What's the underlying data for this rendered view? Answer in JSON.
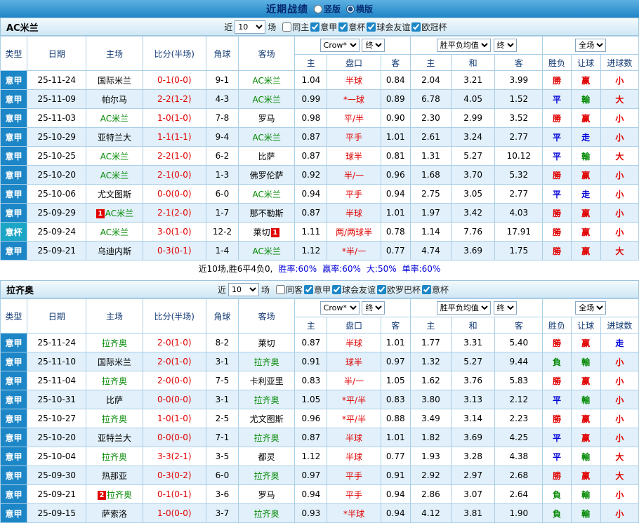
{
  "topbar": {
    "title": "近期战绩",
    "vertical_label": "竖版",
    "horizontal_label": "横版",
    "selected": "横版"
  },
  "table_header": {
    "type": "类型",
    "date": "日期",
    "home": "主场",
    "score": "比分(半场)",
    "corner": "角球",
    "away": "客场",
    "odds_select": "Crow*",
    "final_select": "终",
    "avg_select": "胜平负均值",
    "scope_select": "全场",
    "sub_cols": [
      "主",
      "盘口",
      "客",
      "主",
      "和",
      "客",
      "胜负",
      "让球",
      "进球数"
    ]
  },
  "colors": {
    "league_bg": "#1c86c7",
    "cup_bg": "#1ba6c6",
    "win_red": "#e10000",
    "draw_blue": "#0000d9",
    "lose_green": "#008800"
  },
  "sections": [
    {
      "team": "AC米兰",
      "filter": {
        "near": "近",
        "count": "10",
        "games": "场",
        "checkboxes": [
          {
            "label": "同主",
            "checked": false
          },
          {
            "label": "意甲",
            "checked": true
          },
          {
            "label": "意杯",
            "checked": true
          },
          {
            "label": "球会友谊",
            "checked": true
          },
          {
            "label": "欧冠杯",
            "checked": true
          }
        ]
      },
      "rows": [
        {
          "type": "意甲",
          "type_c": "league",
          "date": "25-11-24",
          "home": "国际米兰",
          "home_green": false,
          "home_badge": "",
          "score": "0-1(0-0)",
          "corner": "9-1",
          "away": "AC米兰",
          "away_green": true,
          "away_badge": "",
          "o1": "1.04",
          "hcap": "半球",
          "o2": "0.84",
          "a1": "2.04",
          "a2": "3.21",
          "a3": "3.99",
          "res": "勝",
          "res_c": "r",
          "let": "赢",
          "let_c": "r",
          "goal": "小",
          "goal_c": "r"
        },
        {
          "type": "意甲",
          "type_c": "league",
          "date": "25-11-09",
          "home": "帕尔马",
          "home_green": false,
          "home_badge": "",
          "score": "2-2(1-2)",
          "corner": "4-3",
          "away": "AC米兰",
          "away_green": true,
          "away_badge": "",
          "o1": "0.99",
          "hcap": "*一球",
          "o2": "0.89",
          "a1": "6.78",
          "a2": "4.05",
          "a3": "1.52",
          "res": "平",
          "res_c": "b",
          "let": "輸",
          "let_c": "g",
          "goal": "大",
          "goal_c": "r"
        },
        {
          "type": "意甲",
          "type_c": "league",
          "date": "25-11-03",
          "home": "AC米兰",
          "home_green": true,
          "home_badge": "",
          "score": "1-0(1-0)",
          "corner": "7-8",
          "away": "罗马",
          "away_green": false,
          "away_badge": "",
          "o1": "0.98",
          "hcap": "平/半",
          "o2": "0.90",
          "a1": "2.30",
          "a2": "2.99",
          "a3": "3.52",
          "res": "勝",
          "res_c": "r",
          "let": "赢",
          "let_c": "r",
          "goal": "小",
          "goal_c": "r"
        },
        {
          "type": "意甲",
          "type_c": "league",
          "date": "25-10-29",
          "home": "亚特兰大",
          "home_green": false,
          "home_badge": "",
          "score": "1-1(1-1)",
          "corner": "9-4",
          "away": "AC米兰",
          "away_green": true,
          "away_badge": "",
          "o1": "0.87",
          "hcap": "平手",
          "o2": "1.01",
          "a1": "2.61",
          "a2": "3.24",
          "a3": "2.77",
          "res": "平",
          "res_c": "b",
          "let": "走",
          "let_c": "b",
          "goal": "小",
          "goal_c": "r"
        },
        {
          "type": "意甲",
          "type_c": "league",
          "date": "25-10-25",
          "home": "AC米兰",
          "home_green": true,
          "home_badge": "",
          "score": "2-2(1-0)",
          "corner": "6-2",
          "away": "比萨",
          "away_green": false,
          "away_badge": "",
          "o1": "0.87",
          "hcap": "球半",
          "o2": "0.81",
          "a1": "1.31",
          "a2": "5.27",
          "a3": "10.12",
          "res": "平",
          "res_c": "b",
          "let": "輸",
          "let_c": "g",
          "goal": "大",
          "goal_c": "r"
        },
        {
          "type": "意甲",
          "type_c": "league",
          "date": "25-10-20",
          "home": "AC米兰",
          "home_green": true,
          "home_badge": "",
          "score": "2-1(0-0)",
          "corner": "1-3",
          "away": "佛罗伦萨",
          "away_green": false,
          "away_badge": "",
          "o1": "0.92",
          "hcap": "半/一",
          "o2": "0.96",
          "a1": "1.68",
          "a2": "3.70",
          "a3": "5.32",
          "res": "勝",
          "res_c": "r",
          "let": "赢",
          "let_c": "r",
          "goal": "小",
          "goal_c": "r"
        },
        {
          "type": "意甲",
          "type_c": "league",
          "date": "25-10-06",
          "home": "尤文图斯",
          "home_green": false,
          "home_badge": "",
          "score": "0-0(0-0)",
          "corner": "6-0",
          "away": "AC米兰",
          "away_green": true,
          "away_badge": "",
          "o1": "0.94",
          "hcap": "平手",
          "o2": "0.94",
          "a1": "2.75",
          "a2": "3.05",
          "a3": "2.77",
          "res": "平",
          "res_c": "b",
          "let": "走",
          "let_c": "b",
          "goal": "小",
          "goal_c": "r"
        },
        {
          "type": "意甲",
          "type_c": "league",
          "date": "25-09-29",
          "home": "AC米兰",
          "home_green": true,
          "home_badge": "1",
          "score": "2-1(2-0)",
          "corner": "1-7",
          "away": "那不勒斯",
          "away_green": false,
          "away_badge": "",
          "o1": "0.87",
          "hcap": "半球",
          "o2": "1.01",
          "a1": "1.97",
          "a2": "3.42",
          "a3": "4.03",
          "res": "勝",
          "res_c": "r",
          "let": "赢",
          "let_c": "r",
          "goal": "小",
          "goal_c": "r"
        },
        {
          "type": "意杯",
          "type_c": "cup",
          "date": "25-09-24",
          "home": "AC米兰",
          "home_green": true,
          "home_badge": "",
          "score": "3-0(1-0)",
          "corner": "12-2",
          "away": "莱切",
          "away_green": false,
          "away_badge": "1",
          "o1": "1.11",
          "hcap": "两/两球半",
          "o2": "0.78",
          "a1": "1.14",
          "a2": "7.76",
          "a3": "17.91",
          "res": "勝",
          "res_c": "r",
          "let": "赢",
          "let_c": "r",
          "goal": "小",
          "goal_c": "r"
        },
        {
          "type": "意甲",
          "type_c": "league",
          "date": "25-09-21",
          "home": "乌迪内斯",
          "home_green": false,
          "home_badge": "",
          "score": "0-3(0-1)",
          "corner": "1-4",
          "away": "AC米兰",
          "away_green": true,
          "away_badge": "",
          "o1": "1.12",
          "hcap": "*半/一",
          "o2": "0.77",
          "a1": "4.74",
          "a2": "3.69",
          "a3": "1.75",
          "res": "勝",
          "res_c": "r",
          "let": "赢",
          "let_c": "r",
          "goal": "大",
          "goal_c": "r"
        }
      ],
      "footer": {
        "plain": "近10场,胜6平4负0,",
        "stats": [
          {
            "text": "胜率:60%",
            "c": "b"
          },
          {
            "text": "赢率:60%",
            "c": "b"
          },
          {
            "text": "大:50%",
            "c": "b"
          },
          {
            "text": "单率:60%",
            "c": "b"
          }
        ]
      }
    },
    {
      "team": "拉齐奥",
      "filter": {
        "near": "近",
        "count": "10",
        "games": "场",
        "checkboxes": [
          {
            "label": "同客",
            "checked": false
          },
          {
            "label": "意甲",
            "checked": true
          },
          {
            "label": "球会友谊",
            "checked": true
          },
          {
            "label": "欧罗巴杯",
            "checked": true
          },
          {
            "label": "意杯",
            "checked": true
          }
        ]
      },
      "rows": [
        {
          "type": "意甲",
          "type_c": "league",
          "date": "25-11-24",
          "home": "拉齐奥",
          "home_green": true,
          "home_badge": "",
          "score": "2-0(1-0)",
          "corner": "8-2",
          "away": "莱切",
          "away_green": false,
          "away_badge": "",
          "o1": "0.87",
          "hcap": "半球",
          "o2": "1.01",
          "a1": "1.77",
          "a2": "3.31",
          "a3": "5.40",
          "res": "勝",
          "res_c": "r",
          "let": "赢",
          "let_c": "r",
          "goal": "走",
          "goal_c": "b"
        },
        {
          "type": "意甲",
          "type_c": "league",
          "date": "25-11-10",
          "home": "国际米兰",
          "home_green": false,
          "home_badge": "",
          "score": "2-0(1-0)",
          "corner": "3-1",
          "away": "拉齐奥",
          "away_green": true,
          "away_badge": "",
          "o1": "0.91",
          "hcap": "球半",
          "o2": "0.97",
          "a1": "1.32",
          "a2": "5.27",
          "a3": "9.44",
          "res": "負",
          "res_c": "g",
          "let": "輸",
          "let_c": "g",
          "goal": "小",
          "goal_c": "r"
        },
        {
          "type": "意甲",
          "type_c": "league",
          "date": "25-11-04",
          "home": "拉齐奥",
          "home_green": true,
          "home_badge": "",
          "score": "2-0(0-0)",
          "corner": "7-5",
          "away": "卡利亚里",
          "away_green": false,
          "away_badge": "",
          "o1": "0.83",
          "hcap": "半/一",
          "o2": "1.05",
          "a1": "1.62",
          "a2": "3.76",
          "a3": "5.83",
          "res": "勝",
          "res_c": "r",
          "let": "赢",
          "let_c": "r",
          "goal": "小",
          "goal_c": "r"
        },
        {
          "type": "意甲",
          "type_c": "league",
          "date": "25-10-31",
          "home": "比萨",
          "home_green": false,
          "home_badge": "",
          "score": "0-0(0-0)",
          "corner": "3-1",
          "away": "拉齐奥",
          "away_green": true,
          "away_badge": "",
          "o1": "1.05",
          "hcap": "*平/半",
          "o2": "0.83",
          "a1": "3.80",
          "a2": "3.13",
          "a3": "2.12",
          "res": "平",
          "res_c": "b",
          "let": "輸",
          "let_c": "g",
          "goal": "小",
          "goal_c": "r"
        },
        {
          "type": "意甲",
          "type_c": "league",
          "date": "25-10-27",
          "home": "拉齐奥",
          "home_green": true,
          "home_badge": "",
          "score": "1-0(1-0)",
          "corner": "2-5",
          "away": "尤文图斯",
          "away_green": false,
          "away_badge": "",
          "o1": "0.96",
          "hcap": "*平/半",
          "o2": "0.88",
          "a1": "3.49",
          "a2": "3.14",
          "a3": "2.23",
          "res": "勝",
          "res_c": "r",
          "let": "赢",
          "let_c": "r",
          "goal": "小",
          "goal_c": "r"
        },
        {
          "type": "意甲",
          "type_c": "league",
          "date": "25-10-20",
          "home": "亚特兰大",
          "home_green": false,
          "home_badge": "",
          "score": "0-0(0-0)",
          "corner": "7-1",
          "away": "拉齐奥",
          "away_green": true,
          "away_badge": "",
          "o1": "0.87",
          "hcap": "半球",
          "o2": "1.01",
          "a1": "1.82",
          "a2": "3.69",
          "a3": "4.25",
          "res": "平",
          "res_c": "b",
          "let": "赢",
          "let_c": "r",
          "goal": "小",
          "goal_c": "r"
        },
        {
          "type": "意甲",
          "type_c": "league",
          "date": "25-10-04",
          "home": "拉齐奥",
          "home_green": true,
          "home_badge": "",
          "score": "3-3(2-1)",
          "corner": "3-5",
          "away": "都灵",
          "away_green": false,
          "away_badge": "",
          "o1": "1.12",
          "hcap": "半球",
          "o2": "0.77",
          "a1": "1.93",
          "a2": "3.28",
          "a3": "4.38",
          "res": "平",
          "res_c": "b",
          "let": "輸",
          "let_c": "g",
          "goal": "大",
          "goal_c": "r"
        },
        {
          "type": "意甲",
          "type_c": "league",
          "date": "25-09-30",
          "home": "热那亚",
          "home_green": false,
          "home_badge": "",
          "score": "0-3(0-2)",
          "corner": "6-0",
          "away": "拉齐奥",
          "away_green": true,
          "away_badge": "",
          "o1": "0.97",
          "hcap": "平手",
          "o2": "0.91",
          "a1": "2.92",
          "a2": "2.97",
          "a3": "2.68",
          "res": "勝",
          "res_c": "r",
          "let": "赢",
          "let_c": "r",
          "goal": "大",
          "goal_c": "r"
        },
        {
          "type": "意甲",
          "type_c": "league",
          "date": "25-09-21",
          "home": "拉齐奥",
          "home_green": true,
          "home_badge": "2",
          "score": "0-1(0-1)",
          "corner": "3-6",
          "away": "罗马",
          "away_green": false,
          "away_badge": "",
          "o1": "0.94",
          "hcap": "平手",
          "o2": "0.94",
          "a1": "2.86",
          "a2": "3.07",
          "a3": "2.64",
          "res": "負",
          "res_c": "g",
          "let": "輸",
          "let_c": "g",
          "goal": "小",
          "goal_c": "r"
        },
        {
          "type": "意甲",
          "type_c": "league",
          "date": "25-09-15",
          "home": "萨索洛",
          "home_green": false,
          "home_badge": "",
          "score": "1-0(0-0)",
          "corner": "3-7",
          "away": "拉齐奥",
          "away_green": true,
          "away_badge": "",
          "o1": "0.93",
          "hcap": "*半球",
          "o2": "0.94",
          "a1": "4.12",
          "a2": "3.81",
          "a3": "1.90",
          "res": "負",
          "res_c": "g",
          "let": "輸",
          "let_c": "g",
          "goal": "小",
          "goal_c": "r"
        }
      ],
      "footer": null
    }
  ]
}
